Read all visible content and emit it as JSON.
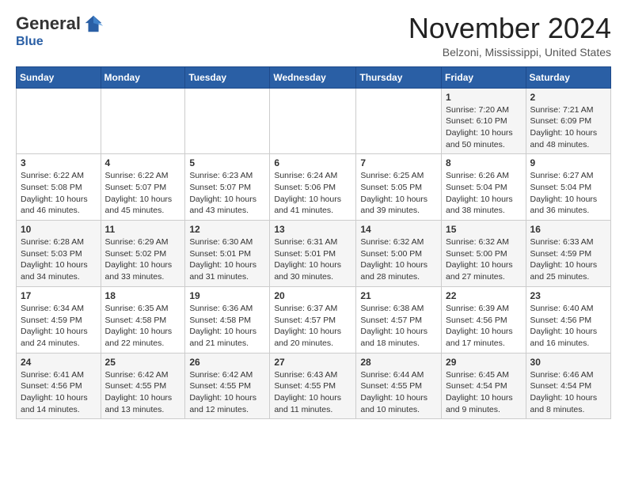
{
  "header": {
    "logo_general": "General",
    "logo_blue": "Blue",
    "month": "November 2024",
    "location": "Belzoni, Mississippi, United States"
  },
  "days_of_week": [
    "Sunday",
    "Monday",
    "Tuesday",
    "Wednesday",
    "Thursday",
    "Friday",
    "Saturday"
  ],
  "weeks": [
    [
      {
        "day": "",
        "info": ""
      },
      {
        "day": "",
        "info": ""
      },
      {
        "day": "",
        "info": ""
      },
      {
        "day": "",
        "info": ""
      },
      {
        "day": "",
        "info": ""
      },
      {
        "day": "1",
        "info": "Sunrise: 7:20 AM\nSunset: 6:10 PM\nDaylight: 10 hours and 50 minutes."
      },
      {
        "day": "2",
        "info": "Sunrise: 7:21 AM\nSunset: 6:09 PM\nDaylight: 10 hours and 48 minutes."
      }
    ],
    [
      {
        "day": "3",
        "info": "Sunrise: 6:22 AM\nSunset: 5:08 PM\nDaylight: 10 hours and 46 minutes."
      },
      {
        "day": "4",
        "info": "Sunrise: 6:22 AM\nSunset: 5:07 PM\nDaylight: 10 hours and 45 minutes."
      },
      {
        "day": "5",
        "info": "Sunrise: 6:23 AM\nSunset: 5:07 PM\nDaylight: 10 hours and 43 minutes."
      },
      {
        "day": "6",
        "info": "Sunrise: 6:24 AM\nSunset: 5:06 PM\nDaylight: 10 hours and 41 minutes."
      },
      {
        "day": "7",
        "info": "Sunrise: 6:25 AM\nSunset: 5:05 PM\nDaylight: 10 hours and 39 minutes."
      },
      {
        "day": "8",
        "info": "Sunrise: 6:26 AM\nSunset: 5:04 PM\nDaylight: 10 hours and 38 minutes."
      },
      {
        "day": "9",
        "info": "Sunrise: 6:27 AM\nSunset: 5:04 PM\nDaylight: 10 hours and 36 minutes."
      }
    ],
    [
      {
        "day": "10",
        "info": "Sunrise: 6:28 AM\nSunset: 5:03 PM\nDaylight: 10 hours and 34 minutes."
      },
      {
        "day": "11",
        "info": "Sunrise: 6:29 AM\nSunset: 5:02 PM\nDaylight: 10 hours and 33 minutes."
      },
      {
        "day": "12",
        "info": "Sunrise: 6:30 AM\nSunset: 5:01 PM\nDaylight: 10 hours and 31 minutes."
      },
      {
        "day": "13",
        "info": "Sunrise: 6:31 AM\nSunset: 5:01 PM\nDaylight: 10 hours and 30 minutes."
      },
      {
        "day": "14",
        "info": "Sunrise: 6:32 AM\nSunset: 5:00 PM\nDaylight: 10 hours and 28 minutes."
      },
      {
        "day": "15",
        "info": "Sunrise: 6:32 AM\nSunset: 5:00 PM\nDaylight: 10 hours and 27 minutes."
      },
      {
        "day": "16",
        "info": "Sunrise: 6:33 AM\nSunset: 4:59 PM\nDaylight: 10 hours and 25 minutes."
      }
    ],
    [
      {
        "day": "17",
        "info": "Sunrise: 6:34 AM\nSunset: 4:59 PM\nDaylight: 10 hours and 24 minutes."
      },
      {
        "day": "18",
        "info": "Sunrise: 6:35 AM\nSunset: 4:58 PM\nDaylight: 10 hours and 22 minutes."
      },
      {
        "day": "19",
        "info": "Sunrise: 6:36 AM\nSunset: 4:58 PM\nDaylight: 10 hours and 21 minutes."
      },
      {
        "day": "20",
        "info": "Sunrise: 6:37 AM\nSunset: 4:57 PM\nDaylight: 10 hours and 20 minutes."
      },
      {
        "day": "21",
        "info": "Sunrise: 6:38 AM\nSunset: 4:57 PM\nDaylight: 10 hours and 18 minutes."
      },
      {
        "day": "22",
        "info": "Sunrise: 6:39 AM\nSunset: 4:56 PM\nDaylight: 10 hours and 17 minutes."
      },
      {
        "day": "23",
        "info": "Sunrise: 6:40 AM\nSunset: 4:56 PM\nDaylight: 10 hours and 16 minutes."
      }
    ],
    [
      {
        "day": "24",
        "info": "Sunrise: 6:41 AM\nSunset: 4:56 PM\nDaylight: 10 hours and 14 minutes."
      },
      {
        "day": "25",
        "info": "Sunrise: 6:42 AM\nSunset: 4:55 PM\nDaylight: 10 hours and 13 minutes."
      },
      {
        "day": "26",
        "info": "Sunrise: 6:42 AM\nSunset: 4:55 PM\nDaylight: 10 hours and 12 minutes."
      },
      {
        "day": "27",
        "info": "Sunrise: 6:43 AM\nSunset: 4:55 PM\nDaylight: 10 hours and 11 minutes."
      },
      {
        "day": "28",
        "info": "Sunrise: 6:44 AM\nSunset: 4:55 PM\nDaylight: 10 hours and 10 minutes."
      },
      {
        "day": "29",
        "info": "Sunrise: 6:45 AM\nSunset: 4:54 PM\nDaylight: 10 hours and 9 minutes."
      },
      {
        "day": "30",
        "info": "Sunrise: 6:46 AM\nSunset: 4:54 PM\nDaylight: 10 hours and 8 minutes."
      }
    ]
  ]
}
